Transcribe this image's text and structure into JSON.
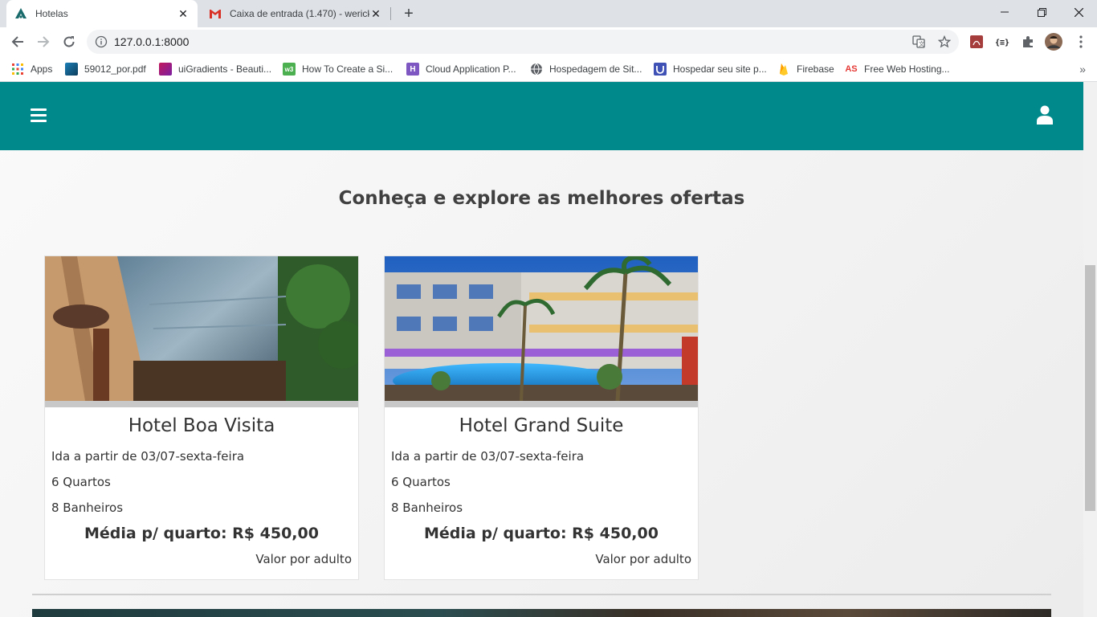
{
  "browser": {
    "tabs": [
      {
        "title": "Hotelas",
        "active": true
      },
      {
        "title": "Caixa de entrada (1.470) - werick",
        "active": false
      }
    ],
    "url": "127.0.0.1:8000",
    "bookmarks": [
      {
        "label": "Apps",
        "icon": "apps-grid-icon"
      },
      {
        "label": "59012_por.pdf",
        "icon": "pdf-icon"
      },
      {
        "label": "uiGradients - Beauti...",
        "icon": "uigradients-icon"
      },
      {
        "label": "How To Create a Si...",
        "icon": "w3-icon"
      },
      {
        "label": "Cloud Application P...",
        "icon": "heroku-icon"
      },
      {
        "label": "Hospedagem de Sit...",
        "icon": "globe-icon"
      },
      {
        "label": "Hospedar seu site p...",
        "icon": "shield-icon"
      },
      {
        "label": "Firebase",
        "icon": "firebase-icon"
      },
      {
        "label": "Free Web Hosting...",
        "icon": "as-icon"
      }
    ]
  },
  "page": {
    "heading": "Conheça e explore as melhores ofertas",
    "hotels": [
      {
        "name": "Hotel Boa Visita",
        "departure": "Ida a partir de 03/07-sexta-feira",
        "rooms": "6 Quartos",
        "bathrooms": "8 Banheiros",
        "price": "Média p/ quarto: R$ 450,00",
        "price_note": "Valor por adulto"
      },
      {
        "name": "Hotel Grand Suite",
        "departure": "Ida a partir de 03/07-sexta-feira",
        "rooms": "6 Quartos",
        "bathrooms": "8 Banheiros",
        "price": "Média p/ quarto: R$ 450,00",
        "price_note": "Valor por adulto"
      }
    ]
  },
  "colors": {
    "appbar": "#00898a",
    "tabbar": "#dee1e6"
  }
}
